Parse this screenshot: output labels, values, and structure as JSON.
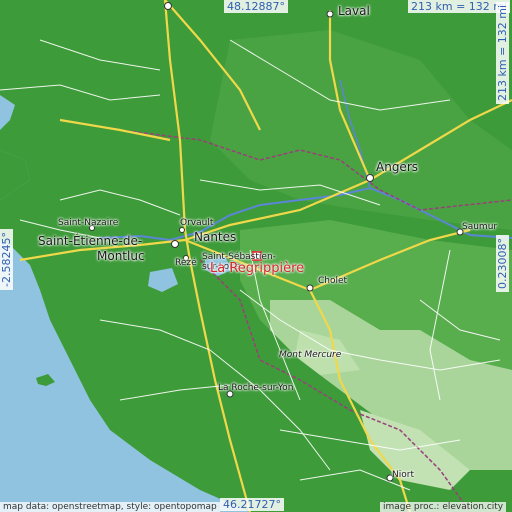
{
  "map": {
    "colors": {
      "sea": "#8fc3df",
      "lowland": "#3e9b3a",
      "hills": "#a9d59a",
      "river": "#5b86d6",
      "road_major": "#f0d84a",
      "road_minor": "#ffffff",
      "border": "#9a3f7a",
      "target": "#d42a2a",
      "coord_text": "#2f5fb0"
    },
    "coords": {
      "top": "48.12887°",
      "bottom": "46.21727°",
      "left": "-2.58245°",
      "right": "0.23008°"
    },
    "scale": {
      "horizontal": "213 km = 132 mi",
      "vertical": "213 km = 132 mi"
    },
    "places": {
      "laval": "Laval",
      "angers": "Angers",
      "saumur": "Saumur",
      "saint_nazaire": "Saint-Nazaire",
      "saint_etienne_1": "Saint-Étienne-de-",
      "saint_etienne_2": "Montluc",
      "orvault": "Orvault",
      "nantes": "Nantes",
      "reze": "Rezé",
      "saint_sebastien_1": "Saint-Sébastien-",
      "saint_sebastien_2": "sur-Loire",
      "target": "La Regrippière",
      "cholet": "Cholet",
      "mont_mercure": "Mont Mercure",
      "la_roche": "La Roche-sur-Yon",
      "niort": "Niort"
    },
    "credits": {
      "left": "map data: openstreetmap, style: opentopomap",
      "right": "image proc.: elevation.city"
    }
  }
}
